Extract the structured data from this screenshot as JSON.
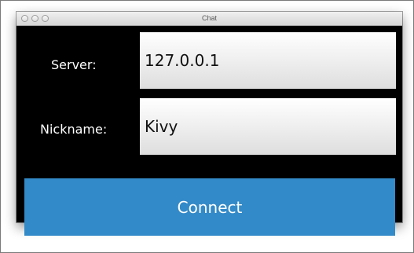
{
  "window": {
    "title": "Chat"
  },
  "form": {
    "server_label": "Server:",
    "server_value": "127.0.0.1",
    "nickname_label": "Nickname:",
    "nickname_value": "Kivy"
  },
  "actions": {
    "connect_label": "Connect"
  },
  "colors": {
    "button_background": "#338ac8",
    "window_background": "#000000",
    "label_text": "#ffffff"
  },
  "icons": [
    "close-icon",
    "minimize-icon",
    "zoom-icon"
  ]
}
